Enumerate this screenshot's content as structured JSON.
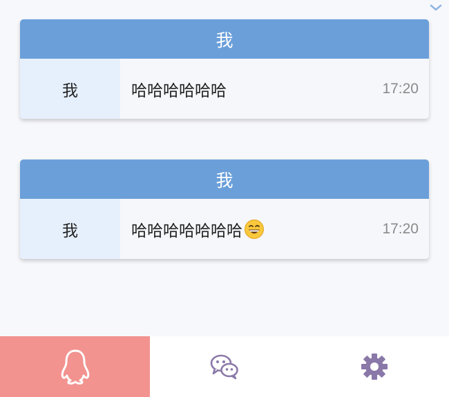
{
  "top": {
    "chevron_icon": "chevron-down-icon"
  },
  "messages": [
    {
      "header": "我",
      "sender": "我",
      "text": "哈哈哈哈哈哈",
      "time": "17:20",
      "emoji": null
    },
    {
      "header": "我",
      "sender": "我",
      "text": "哈哈哈哈哈哈哈",
      "time": "17:20",
      "emoji": "grinning-face"
    }
  ],
  "bottom_nav": {
    "tabs": [
      {
        "icon": "qq-penguin-icon",
        "active": true
      },
      {
        "icon": "wechat-icon",
        "active": false
      },
      {
        "icon": "gear-icon",
        "active": false
      }
    ]
  },
  "colors": {
    "header_blue": "#6b9fd9",
    "side_blue": "#e6f0fd",
    "active_tab": "#f2938f",
    "icon_purple": "#8a78a8"
  }
}
